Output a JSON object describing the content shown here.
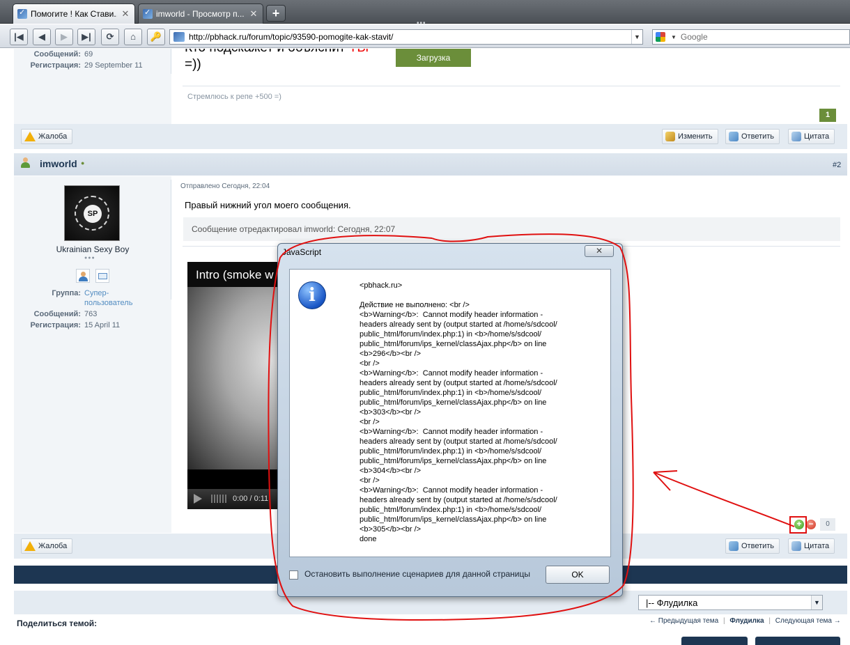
{
  "browser": {
    "tabs": [
      {
        "title": "Помогите ! Как Стави..."
      },
      {
        "title": "imworld - Просмотр п..."
      }
    ],
    "new_tab": "+",
    "url": "http://pbhack.ru/forum/topic/93590-pomogite-kak-stavit/",
    "search_placeholder": "Google"
  },
  "post1": {
    "messages_label": "Сообщений:",
    "messages": "69",
    "reg_label": "Регистрация:",
    "reg_date": "29 September 11",
    "text_line1": "Кто подскажет и объяснит",
    "text_line1_red": "ТЫ",
    "text_line2": "=))",
    "loading": "Загрузка",
    "signature": "Стремлюсь к репе +500 =)",
    "rep": "1",
    "complaint": "Жалоба",
    "edit": "Изменить",
    "reply": "Ответить",
    "quote": "Цитата"
  },
  "post2": {
    "author": "imworld",
    "number": "#2",
    "avatar_text": "SP",
    "user_title": "Ukrainian Sexy Boy",
    "group_label": "Группа:",
    "group_line1": "Супер-",
    "group_line2": "пользователь",
    "messages_label": "Сообщений:",
    "messages": "763",
    "reg_label": "Регистрация:",
    "reg_date": "15 April 11",
    "posted": "Отправлено Сегодня, 22:04",
    "text": "Правый нижний угол моего сообщения.",
    "edited": "Сообщение отредактировал imworld: Сегодня, 22:07",
    "video_title": "Intro (smoke w",
    "video_time": "0:00 / 0:11",
    "rep": "0",
    "complaint": "Жалоба",
    "reply": "Ответить",
    "quote": "Цитата"
  },
  "footer": {
    "forum_select": "|-- Флудилка",
    "share": "Поделиться темой:",
    "prev": "← Предыдущая тема",
    "current": "Флудилка",
    "next": "Следующая тема →"
  },
  "dialog": {
    "title": "JavaScript",
    "message": "<pbhack.ru>\n\nДействие не выполнено: <br />\n<b>Warning</b>:  Cannot modify header information -\nheaders already sent by (output started at /home/s/sdcool/\npublic_html/forum/index.php:1) in <b>/home/s/sdcool/\npublic_html/forum/ips_kernel/classAjax.php</b> on line\n<b>296</b><br />\n<br />\n<b>Warning</b>:  Cannot modify header information -\nheaders already sent by (output started at /home/s/sdcool/\npublic_html/forum/index.php:1) in <b>/home/s/sdcool/\npublic_html/forum/ips_kernel/classAjax.php</b> on line\n<b>303</b><br />\n<br />\n<b>Warning</b>:  Cannot modify header information -\nheaders already sent by (output started at /home/s/sdcool/\npublic_html/forum/index.php:1) in <b>/home/s/sdcool/\npublic_html/forum/ips_kernel/classAjax.php</b> on line\n<b>304</b><br />\n<br />\n<b>Warning</b>:  Cannot modify header information -\nheaders already sent by (output started at /home/s/sdcool/\npublic_html/forum/index.php:1) in <b>/home/s/sdcool/\npublic_html/forum/ips_kernel/classAjax.php</b> on line\n<b>305</b><br />\ndone",
    "checkbox_label": "Остановить выполнение сценариев для данной страницы",
    "ok": "OK"
  },
  "colors": {
    "accent": "#1d3652",
    "annotation": "#e01010",
    "rep_positive": "#6b8e3a"
  }
}
